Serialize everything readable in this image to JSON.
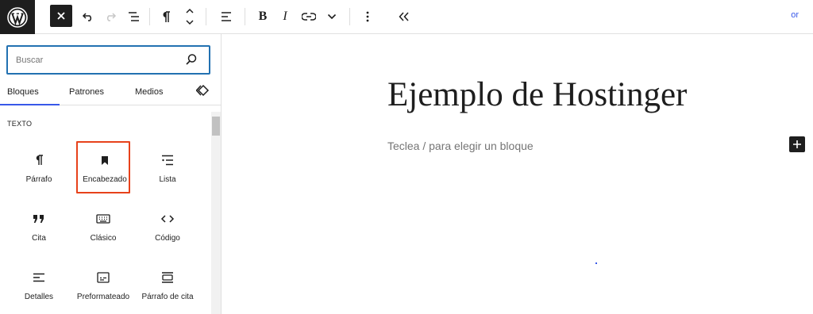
{
  "toolbar": {
    "trailing_text": "or",
    "bold_label": "B",
    "italic_label": "I",
    "icons": [
      "wordpress-icon",
      "close-icon",
      "undo-icon",
      "redo-icon",
      "list-view-icon",
      "paragraph-icon",
      "move-up-down-icon",
      "align-icon",
      "bold-icon",
      "italic-icon",
      "link-icon",
      "chevron-down-icon",
      "more-options-icon",
      "collapse-icon"
    ]
  },
  "inserter": {
    "search": {
      "placeholder": "Buscar",
      "value": ""
    },
    "tabs": [
      {
        "label": "Bloques",
        "active": true
      },
      {
        "label": "Patrones",
        "active": false
      },
      {
        "label": "Medios",
        "active": false
      }
    ],
    "category": "TEXTO",
    "blocks": [
      {
        "label": "Párrafo",
        "icon": "paragraph-icon"
      },
      {
        "label": "Encabezado",
        "icon": "heading-bookmark-icon",
        "highlighted": true
      },
      {
        "label": "Lista",
        "icon": "list-icon"
      },
      {
        "label": "Cita",
        "icon": "quote-icon"
      },
      {
        "label": "Clásico",
        "icon": "keyboard-icon"
      },
      {
        "label": "Código",
        "icon": "code-icon"
      },
      {
        "label": "Detalles",
        "icon": "details-icon"
      },
      {
        "label": "Preformateado",
        "icon": "preformatted-icon"
      },
      {
        "label": "Párrafo de cita",
        "icon": "pullquote-icon"
      }
    ]
  },
  "canvas": {
    "title": "Ejemplo de Hostinger",
    "block_placeholder": "Teclea / para elegir un bloque"
  },
  "colors": {
    "accent": "#3858e9",
    "highlight": "#e7421b",
    "dark": "#1e1e1e"
  }
}
